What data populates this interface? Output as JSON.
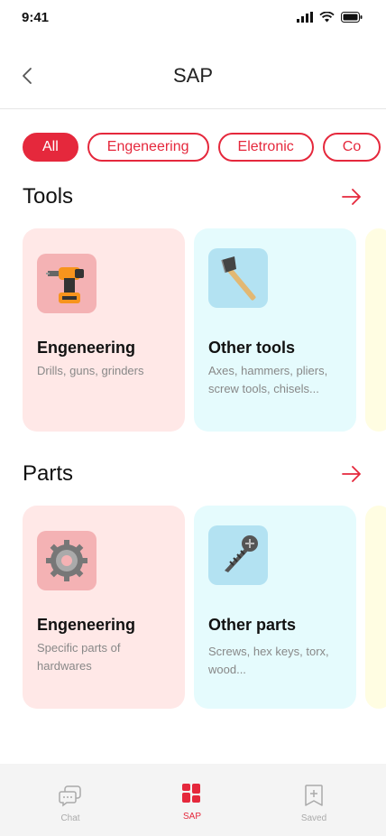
{
  "status": {
    "time": "9:41"
  },
  "header": {
    "title": "SAP"
  },
  "filters": [
    "All",
    "Engeneering",
    "Eletronic",
    "Co"
  ],
  "sections": {
    "tools": {
      "title": "Tools",
      "cards": [
        {
          "title": "Engeneering",
          "desc": "Drills, guns, grinders",
          "icon": "drill-icon"
        },
        {
          "title": "Other tools",
          "desc": "Axes, hammers, pliers, screw tools, chisels...",
          "icon": "axe-icon"
        }
      ]
    },
    "parts": {
      "title": "Parts",
      "cards": [
        {
          "title": "Engeneering",
          "desc": "Specific parts of hardwares",
          "icon": "gear-icon"
        },
        {
          "title": "Other parts",
          "desc": "Screws, hex keys, torx, wood...",
          "icon": "screw-icon"
        }
      ]
    }
  },
  "tabs": [
    "Chat",
    "SAP",
    "Saved"
  ],
  "colors": {
    "accent": "#e5283c",
    "pink_card": "#ffe8e7",
    "cyan_card": "#e5fbfd",
    "yellow_card": "#fffde2"
  }
}
